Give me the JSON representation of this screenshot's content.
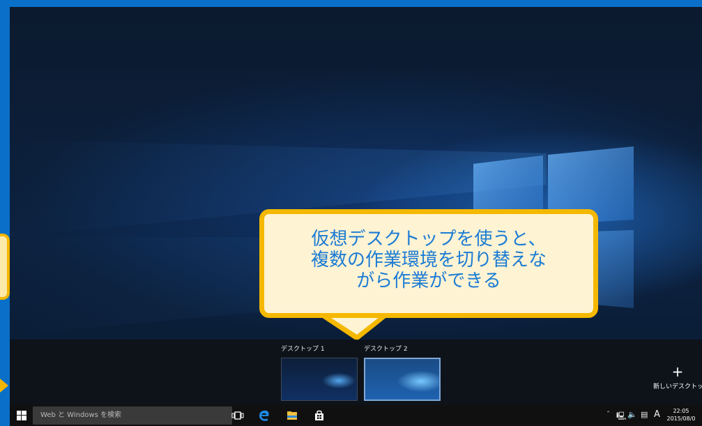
{
  "callout": {
    "line1": "仮想デスクトップを使うと、",
    "line2": "複数の作業環境を切り替えな",
    "line3": "がら作業ができる"
  },
  "task_view": {
    "desktops": [
      {
        "label": "デスクトップ 1",
        "active": false
      },
      {
        "label": "デスクトップ 2",
        "active": true
      }
    ],
    "new_desktop_label": "新しいデスクトップ"
  },
  "taskbar": {
    "search_placeholder": "Web と Windows を検索",
    "icons": [
      "windows-logo-icon",
      "task-view-icon",
      "edge-icon",
      "file-explorer-icon",
      "store-icon"
    ],
    "tray": {
      "ime_indicator": "A",
      "time": "22:05",
      "date": "2015/08/0"
    }
  },
  "colors": {
    "accent_blue": "#0a6fc8",
    "callout_border": "#f5b800",
    "callout_fill": "#fef3d3",
    "callout_text": "#1b7bd4"
  }
}
